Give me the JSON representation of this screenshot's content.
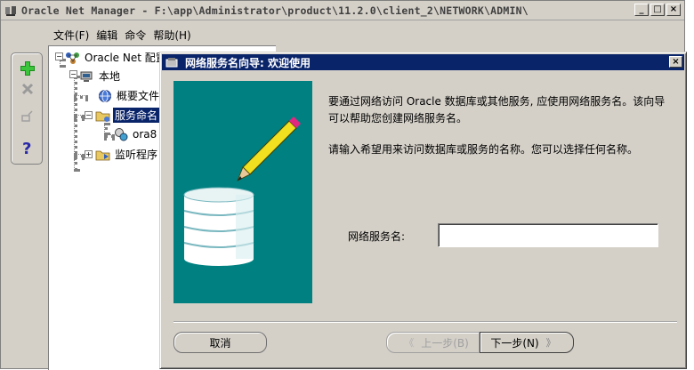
{
  "window": {
    "title": "Oracle Net Manager - F:\\app\\Administrator\\product\\11.2.0\\client_2\\NETWORK\\ADMIN\\",
    "minimize": "_",
    "maximize": "□",
    "close": "×"
  },
  "menu": [
    "文件(F)",
    "编辑",
    "命令",
    "帮助(H)"
  ],
  "toolbar": [
    "add-icon",
    "delete-icon",
    "test-icon",
    "help-icon"
  ],
  "tree": {
    "root": "Oracle Net 配置",
    "local": "本地",
    "profile": "概要文件",
    "service_naming": "服务命名",
    "ora8": "ora8",
    "listeners": "监听程序"
  },
  "dialog": {
    "title": "网络服务名向导: 欢迎使用",
    "close": "×",
    "intro": "要通过网络访问 Oracle 数据库或其他服务, 应使用网络服务名。该向导可以帮助您创建网络服务名。",
    "prompt": "请输入希望用来访问数据库或服务的名称。您可以选择任何名称。",
    "field_label": "网络服务名:",
    "field_value": "",
    "buttons": {
      "cancel": "取消",
      "back": "上一步(B)",
      "next": "下一步(N)"
    }
  },
  "colors": {
    "accent": "#0a246a",
    "wizard_bg": "#008080",
    "face": "#d4d0c8"
  }
}
